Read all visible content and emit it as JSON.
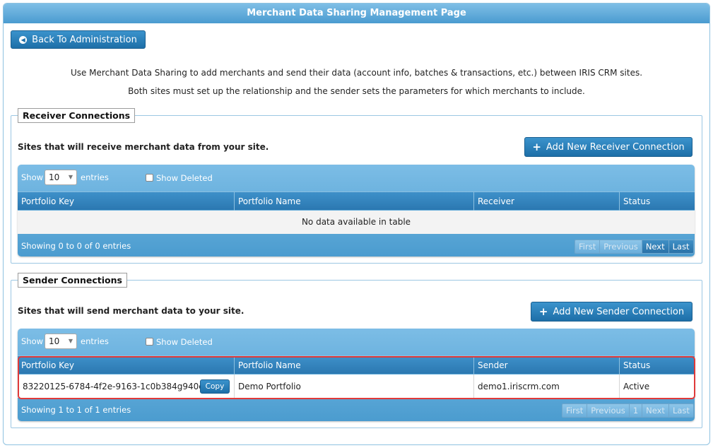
{
  "page": {
    "title": "Merchant Data Sharing Management Page",
    "back_button": "Back To Administration",
    "description_line1": "Use Merchant Data Sharing to add merchants and send their data (account info, batches & transactions, etc.) between IRIS CRM sites.",
    "description_line2": "Both sites must set up the relationship and the sender sets the parameters for which merchants to include."
  },
  "receiver": {
    "legend": "Receiver Connections",
    "subtext": "Sites that will receive merchant data from your site.",
    "add_button": "Add New Receiver Connection",
    "show_label": "Show",
    "entries_value": "10",
    "entries_label": "entries",
    "show_deleted": "Show Deleted",
    "columns": [
      "Portfolio Key",
      "Portfolio Name",
      "Receiver",
      "Status"
    ],
    "empty_message": "No data available in table",
    "info": "Showing 0 to 0 of 0 entries",
    "pager": [
      "First",
      "Previous",
      "Next",
      "Last"
    ]
  },
  "sender": {
    "legend": "Sender Connections",
    "subtext": "Sites that will send merchant data to your site.",
    "add_button": "Add New Sender Connection",
    "show_label": "Show",
    "entries_value": "10",
    "entries_label": "entries",
    "show_deleted": "Show Deleted",
    "columns": [
      "Portfolio Key",
      "Portfolio Name",
      "Sender",
      "Status"
    ],
    "rows": [
      {
        "portfolio_key": "83220125-6784-4f2e-9163-1c0b384g940c",
        "copy": "Copy",
        "portfolio_name": "Demo Portfolio",
        "sender": "demo1.iriscrm.com",
        "status": "Active"
      }
    ],
    "info": "Showing 1 to 1 of 1 entries",
    "pager": [
      "First",
      "Previous",
      "1",
      "Next",
      "Last"
    ]
  },
  "colors": {
    "accent": "#1d6fa8",
    "header": "#4a9bd0",
    "highlight": "#e03a3a"
  }
}
